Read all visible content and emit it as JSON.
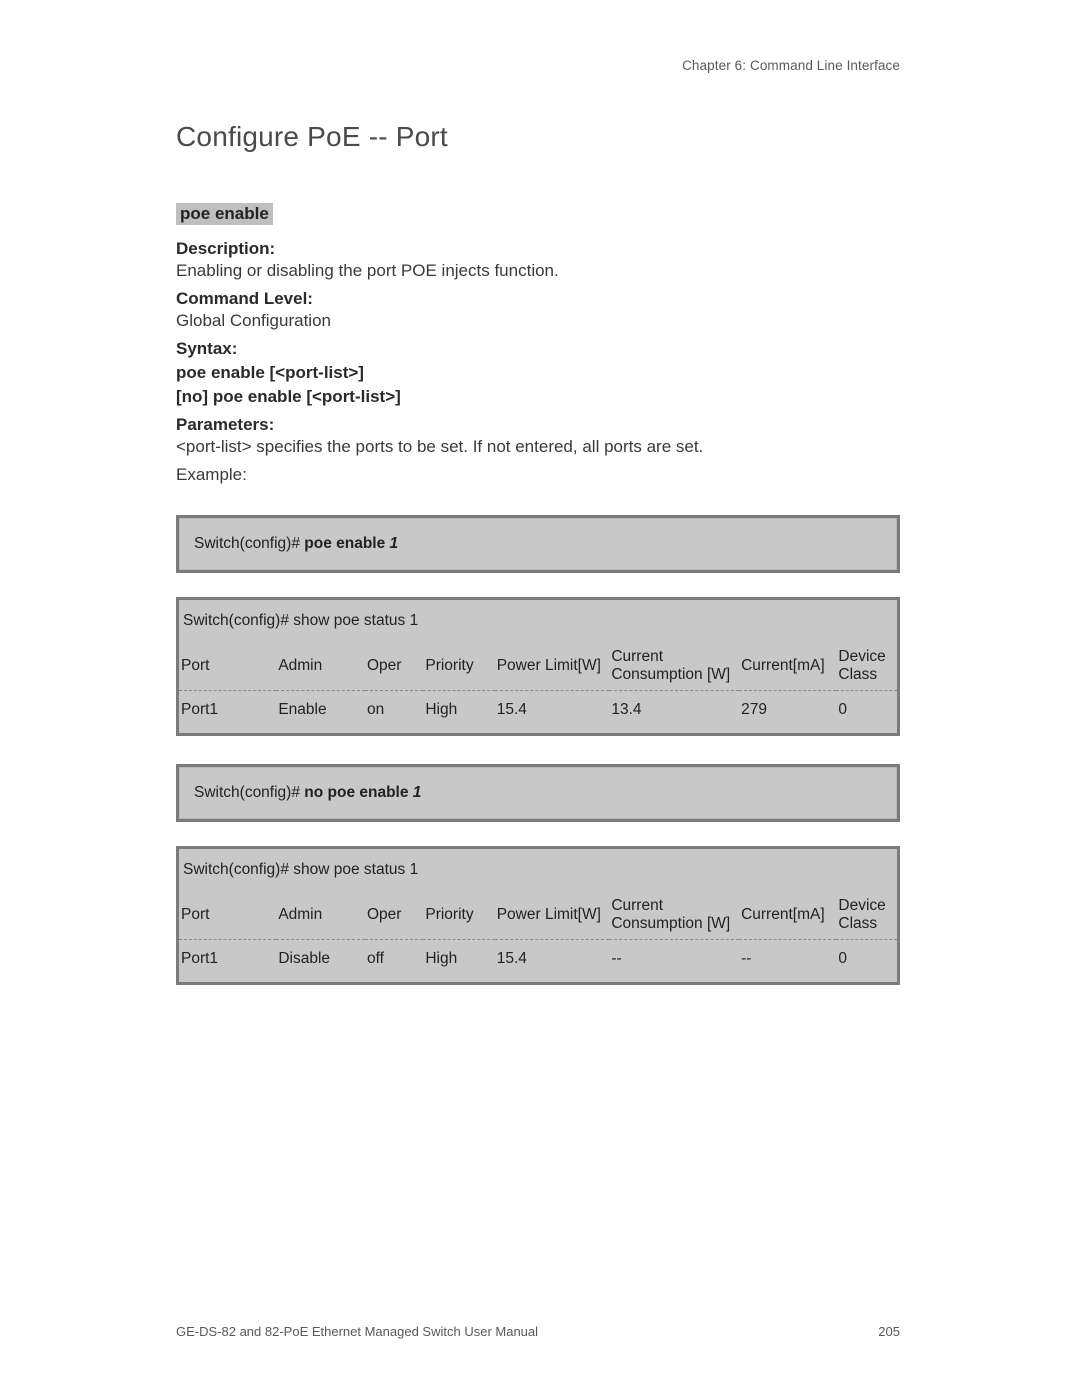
{
  "chapter": "Chapter 6: Command Line Interface",
  "title": "Configure PoE -- Port",
  "cmd_name": "poe enable",
  "labels": {
    "description": "Description:",
    "command_level": "Command Level:",
    "syntax": "Syntax:",
    "parameters": "Parameters:"
  },
  "description_body": "Enabling or disabling the port POE injects function.",
  "command_level_body": "Global Configuration",
  "syntax_lines": [
    "poe enable [<port-list>]",
    "[no] poe enable [<port-list>]"
  ],
  "parameters_body": "<port-list> specifies the ports to be set. If not entered, all ports are set.",
  "example_label": "Example:",
  "cli_box_1": {
    "prompt": "Switch(config)# ",
    "cmd": "poe enable ",
    "arg": "1"
  },
  "table1": {
    "cmd_prompt": "Switch(config)# show poe status ",
    "cmd_arg": "1",
    "headers": [
      "Port",
      "Admin",
      "Oper",
      "Priority",
      "Power Limit[W]",
      "Current Consumption [W]",
      "Current[mA]",
      "Device Class"
    ],
    "row": [
      "Port1",
      "Enable",
      "on",
      "High",
      "15.4",
      "13.4",
      "279",
      "0"
    ]
  },
  "cli_box_2": {
    "prompt": "Switch(config)# ",
    "cmd": "no poe enable ",
    "arg": "1"
  },
  "table2": {
    "cmd_prompt": "Switch(config)# show poe status ",
    "cmd_arg": "1",
    "headers": [
      "Port",
      "Admin",
      "Oper",
      "Priority",
      "Power Limit[W]",
      "Current Consumption [W]",
      "Current[mA]",
      "Device Class"
    ],
    "row": [
      "Port1",
      "Disable",
      "off",
      "High",
      "15.4",
      "--",
      "--",
      "0"
    ]
  },
  "footer": {
    "manual": "GE-DS-82 and 82-PoE Ethernet Managed Switch User Manual",
    "page": "205"
  }
}
